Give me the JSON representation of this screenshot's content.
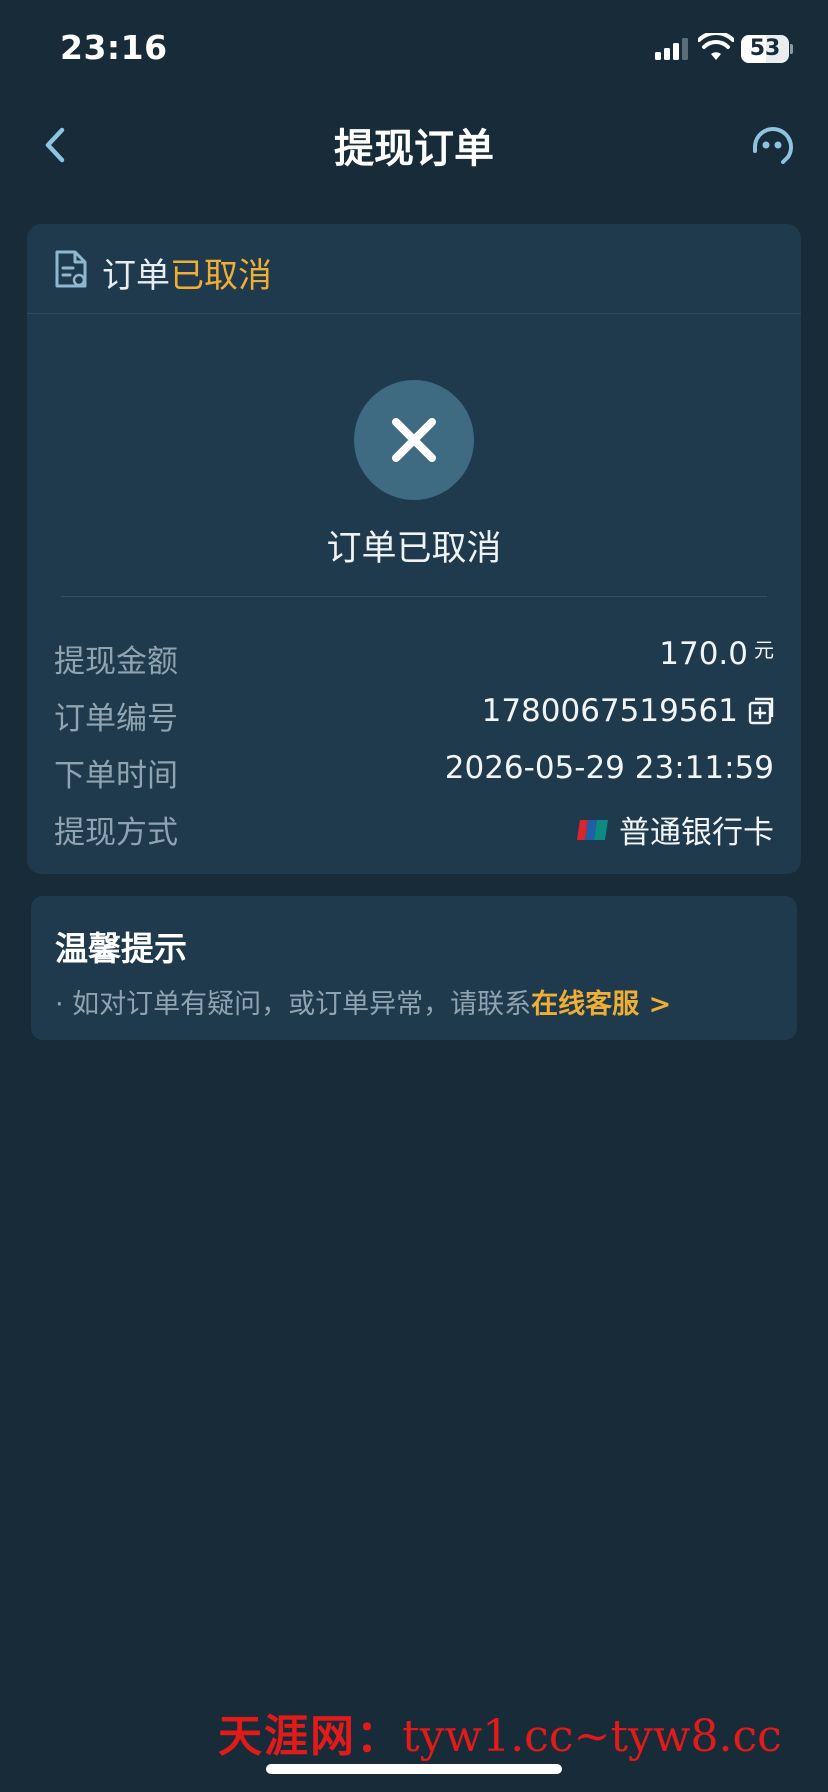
{
  "status_bar": {
    "time": "23:16",
    "battery_percent": "53",
    "battery_level": 0.53
  },
  "nav": {
    "title": "提现订单"
  },
  "order_card": {
    "header_prefix": "订单",
    "header_status": "已取消",
    "status_text": "订单已取消",
    "rows": [
      {
        "label": "提现金额",
        "value": "170.0",
        "unit": "元"
      },
      {
        "label": "订单编号",
        "value": "1780067519561"
      },
      {
        "label": "下单时间",
        "value": "2026-05-29 23:11:59"
      },
      {
        "label": "提现方式",
        "value": "普通银行卡"
      }
    ]
  },
  "tips": {
    "title": "温馨提示",
    "text": "· 如对订单有疑问，或订单异常，请联系",
    "link": "在线客服 >"
  },
  "watermark": {
    "cn": "天涯网：",
    "url": "tyw1.cc~tyw8.cc"
  },
  "colors": {
    "background": "#172b38",
    "card": "#1f3a4d",
    "accent": "#efaf35",
    "cancel_circle": "#3e6a82",
    "watermark": "#e11a1a"
  }
}
